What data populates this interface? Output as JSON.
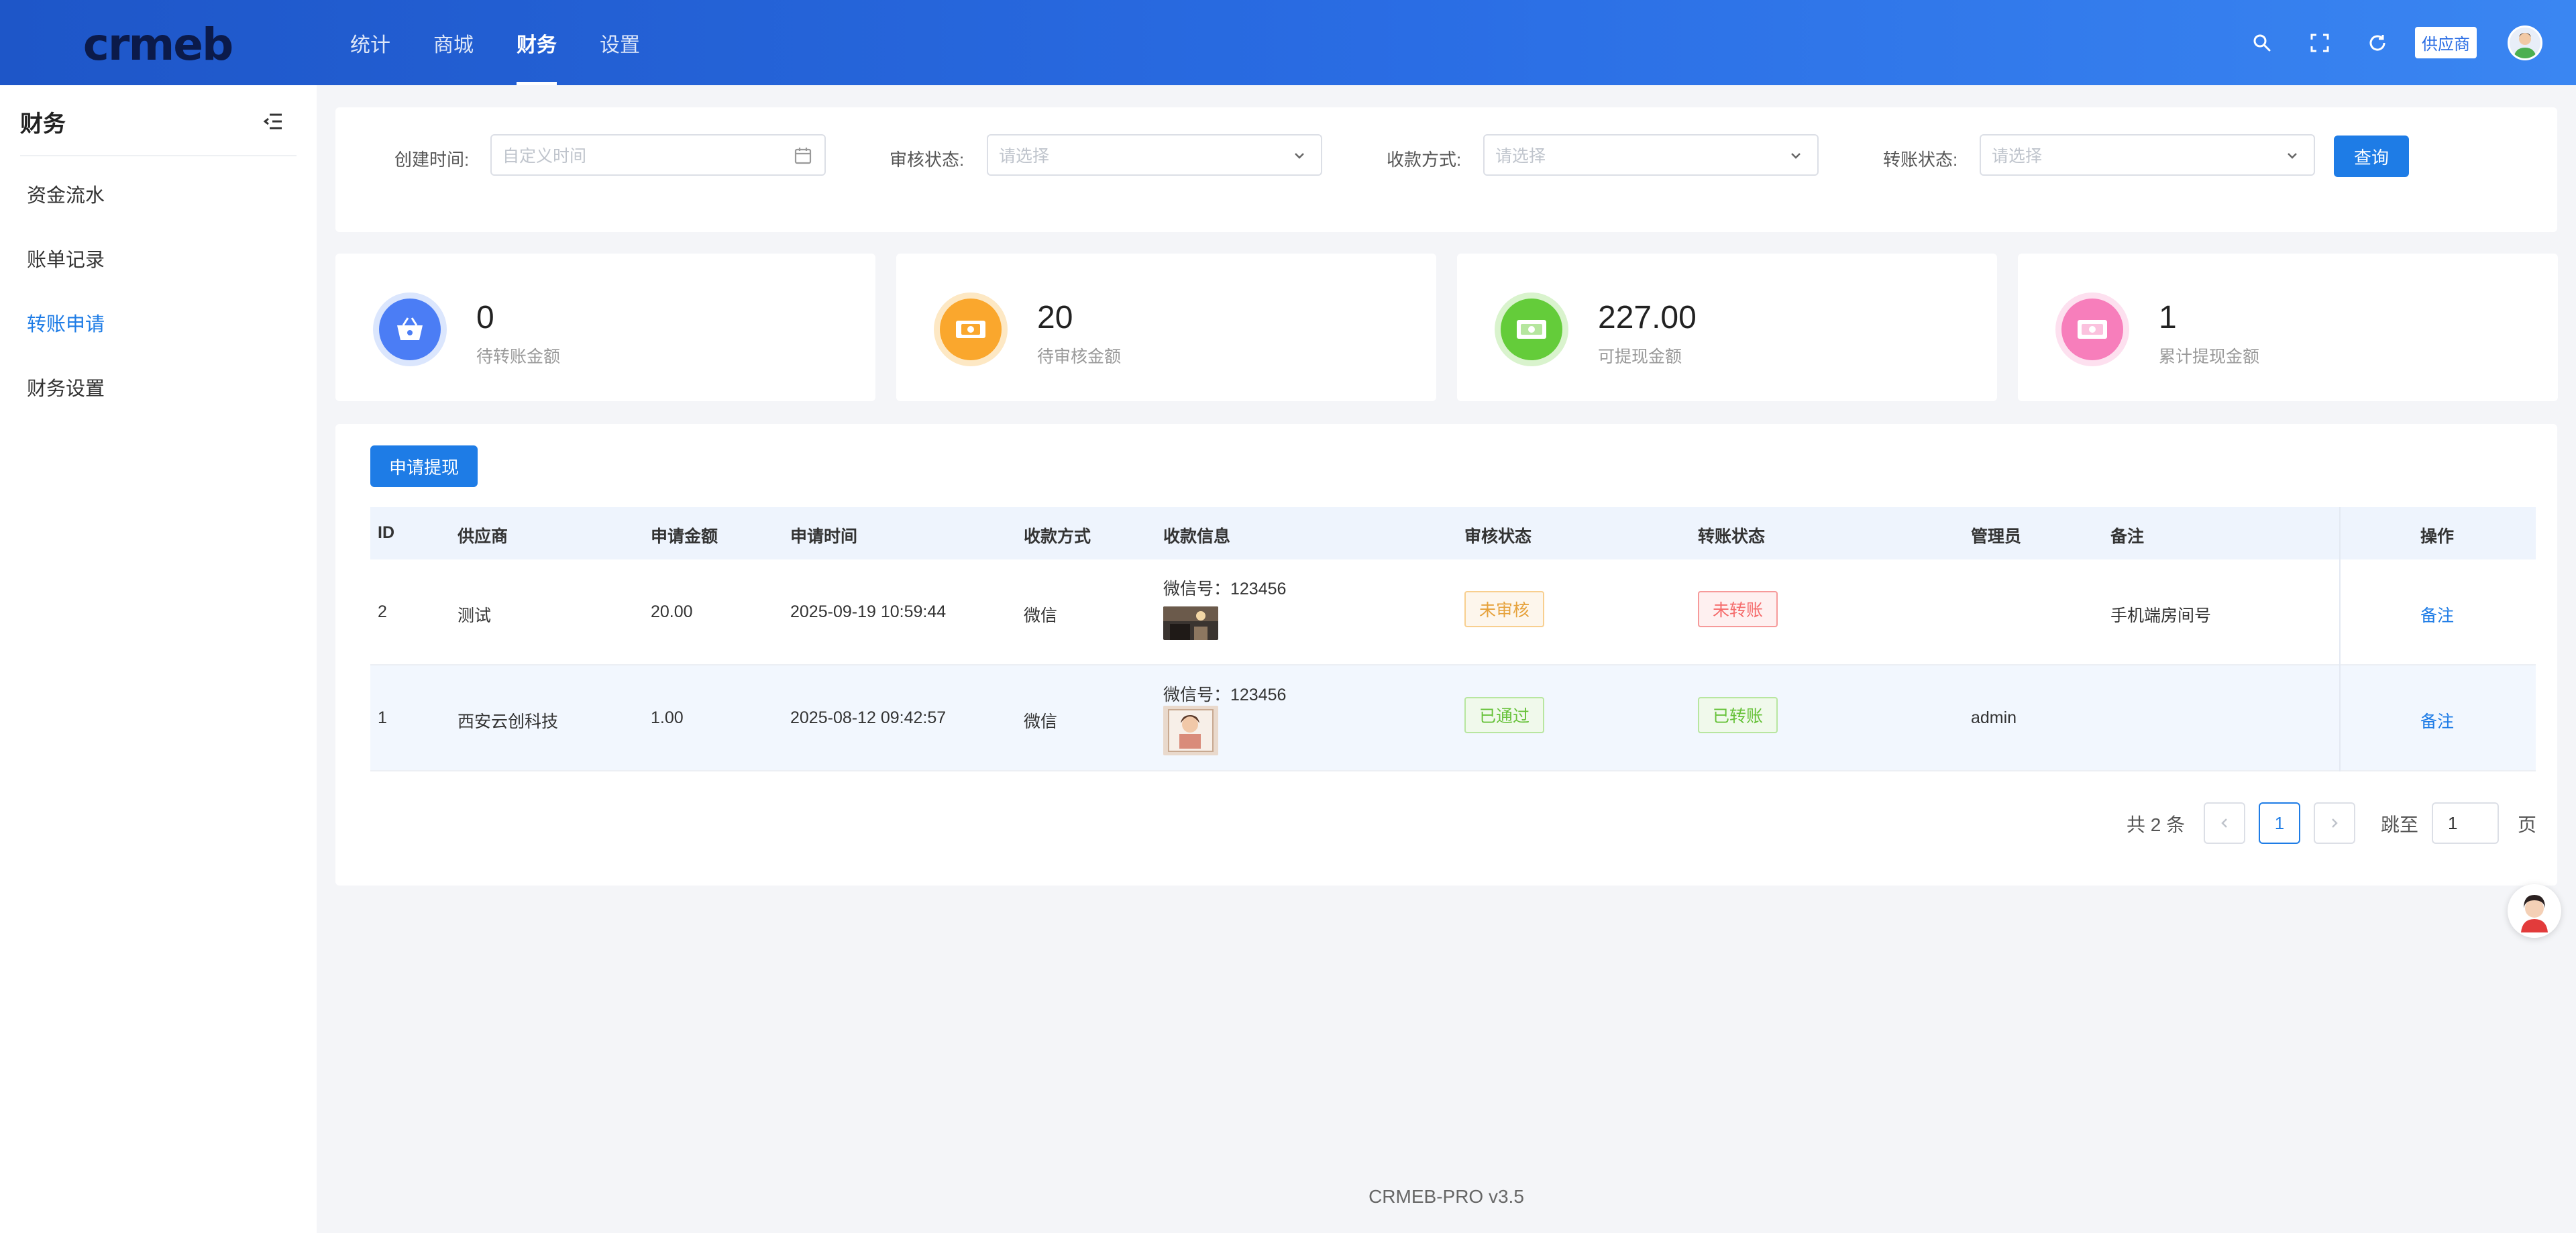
{
  "header": {
    "logo_text": "crmeb",
    "tabs": [
      {
        "label": "统计"
      },
      {
        "label": "商城"
      },
      {
        "label": "财务",
        "active": true
      },
      {
        "label": "设置"
      }
    ],
    "supplier_tag": "供应商",
    "icons": [
      "search-icon",
      "fullscreen-icon",
      "refresh-icon"
    ]
  },
  "sidebar": {
    "title": "财务",
    "items": [
      {
        "label": "资金流水"
      },
      {
        "label": "账单记录"
      },
      {
        "label": "转账申请",
        "active": true
      },
      {
        "label": "财务设置"
      }
    ]
  },
  "filters": {
    "create_time": {
      "label": "创建时间:",
      "placeholder": "自定义时间"
    },
    "audit_status": {
      "label": "审核状态:",
      "placeholder": "请选择"
    },
    "pay_method": {
      "label": "收款方式:",
      "placeholder": "请选择"
    },
    "transfer_status": {
      "label": "转账状态:",
      "placeholder": "请选择"
    },
    "query_label": "查询"
  },
  "stats": [
    {
      "value": "0",
      "label": "待转账金额",
      "color": "#4b7df5",
      "ring": "#dbe6fd",
      "icon": "basket-icon"
    },
    {
      "value": "20",
      "label": "待审核金额",
      "color": "#faa72d",
      "ring": "#fde8c4",
      "icon": "cash-icon"
    },
    {
      "value": "227.00",
      "label": "可提现金额",
      "color": "#64cc3a",
      "ring": "#d9f3cd",
      "icon": "wallet-icon"
    },
    {
      "value": "1",
      "label": "累计提现金额",
      "color": "#f77ebb",
      "ring": "#fde0ef",
      "icon": "money-icon"
    }
  ],
  "table": {
    "apply_label": "申请提现",
    "columns": [
      "ID",
      "供应商",
      "申请金额",
      "申请时间",
      "收款方式",
      "收款信息",
      "审核状态",
      "转账状态",
      "管理员",
      "备注",
      "操作"
    ],
    "rows": [
      {
        "id": "2",
        "supplier": "测试",
        "amount": "20.00",
        "time": "2025-09-19 10:59:44",
        "method": "微信",
        "info": "微信号：123456",
        "audit": "未审核",
        "transfer": "未转账",
        "admin": "",
        "remark": "手机端房间号",
        "op": "备注"
      },
      {
        "id": "1",
        "supplier": "西安云创科技",
        "amount": "1.00",
        "time": "2025-08-12 09:42:57",
        "method": "微信",
        "info": "微信号：123456",
        "audit": "已通过",
        "transfer": "已转账",
        "admin": "admin",
        "remark": "",
        "op": "备注"
      }
    ]
  },
  "pagination": {
    "total": "共 2 条",
    "current": "1",
    "jump_label": "跳至",
    "jump_value": "1",
    "page_suffix": "页"
  },
  "footer": {
    "text": "CRMEB-PRO v3.5"
  }
}
